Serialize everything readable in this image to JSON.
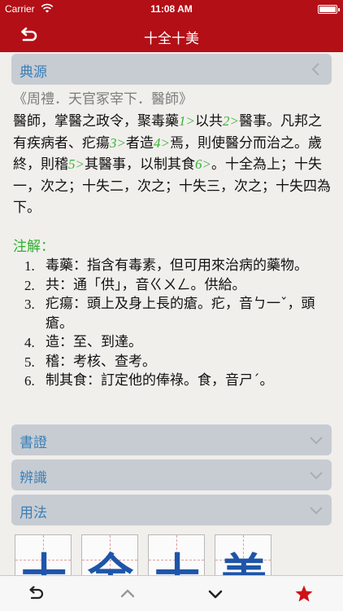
{
  "status_bar": {
    "carrier": "Carrier",
    "time": "11:08 AM"
  },
  "nav": {
    "title": "十全十美"
  },
  "sections": {
    "source": "典源",
    "book_evidence": "書證",
    "discrimination": "辨識",
    "usage": "用法"
  },
  "source": {
    "citation": "《周禮．天官冢宰下．醫師》",
    "body": [
      {
        "t": "醫師，掌醫之政令，聚毒藥"
      },
      {
        "r": "1>"
      },
      {
        "t": "以共"
      },
      {
        "r": "2>"
      },
      {
        "t": "醫事。凡邦之有疾病者、疕瘍"
      },
      {
        "r": "3>"
      },
      {
        "t": "者造"
      },
      {
        "r": "4>"
      },
      {
        "t": "焉，則使醫分而治之。歲終，則稽"
      },
      {
        "r": "5>"
      },
      {
        "t": "其醫事，以制其食"
      },
      {
        "r": "6>"
      },
      {
        "t": "。十全為上；十失一，次之；十失二，次之；十失三，次之；十失四為下。"
      }
    ],
    "notes_title": "注解：",
    "notes": [
      {
        "num": "1.",
        "text": "毒藥：指含有毒素，但可用來治病的藥物。"
      },
      {
        "num": "2.",
        "text": "共：通「供」，音ㄍㄨㄥ。供給。"
      },
      {
        "num": "3.",
        "text": "疕瘍：頭上及身上長的瘡。疕，音ㄅ一ˇ，頭瘡。"
      },
      {
        "num": "4.",
        "text": "造：至、到達。"
      },
      {
        "num": "5.",
        "text": "稽：考核、查考。"
      },
      {
        "num": "6.",
        "text": "制其食：訂定他的俸祿。食，音ㄕˊ。"
      }
    ]
  },
  "tiles": [
    "十",
    "全",
    "十",
    "美"
  ],
  "colors": {
    "brand": "#b30f16",
    "section_text": "#3a7fb6",
    "note_green": "#2fb030",
    "star": "#d01018"
  }
}
